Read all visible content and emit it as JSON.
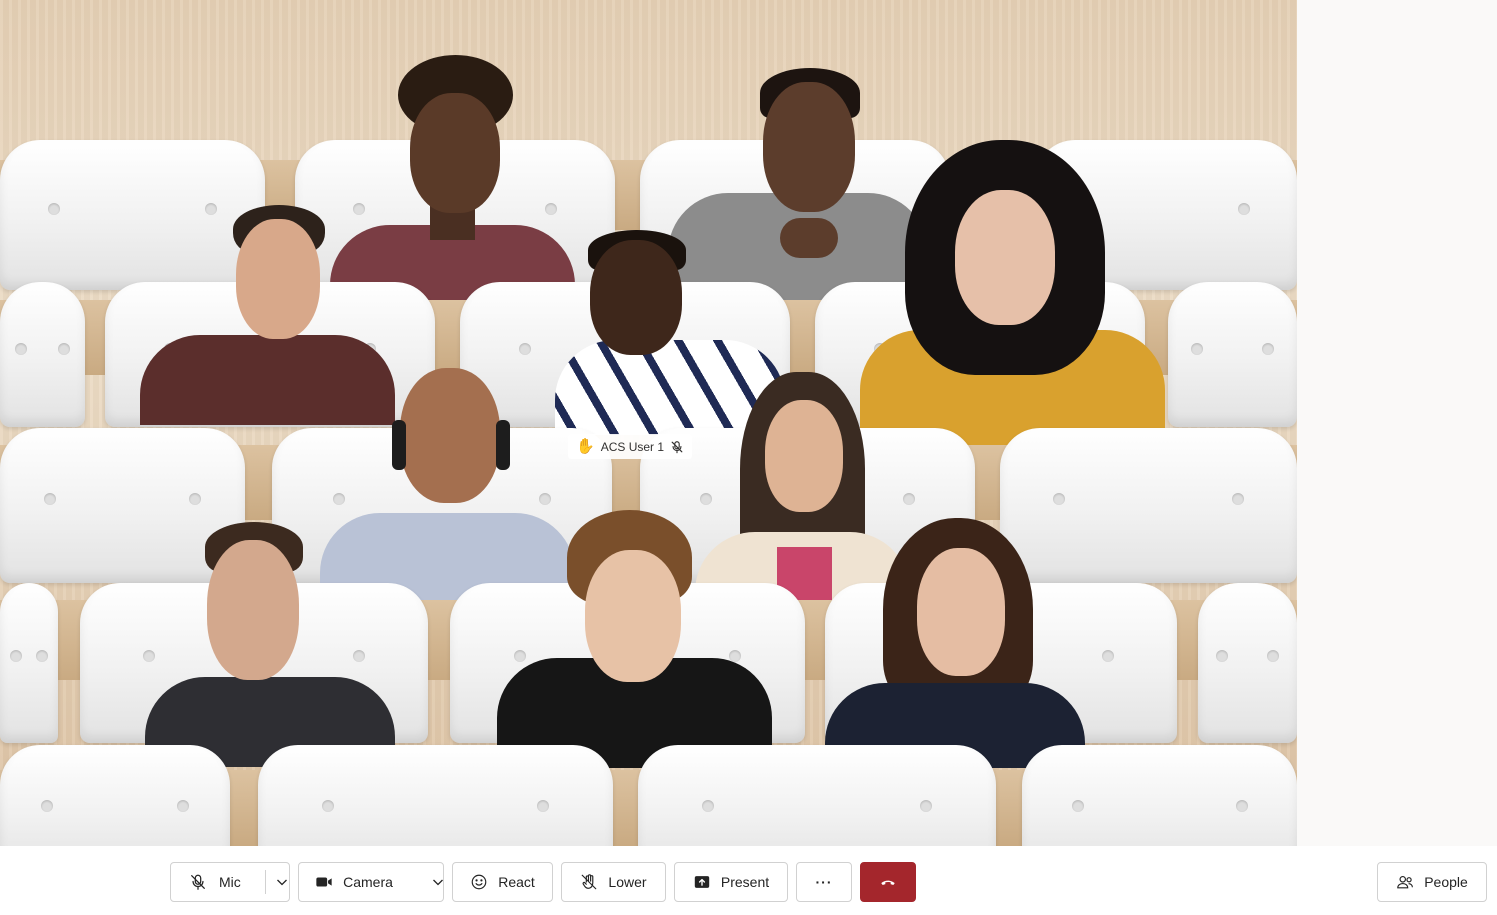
{
  "participant_tag": {
    "name": "ACS User 1",
    "hand_raised_icon": "raised-hand-icon",
    "muted_icon": "mic-off-icon"
  },
  "controls": {
    "mic_label": "Mic",
    "camera_label": "Camera",
    "react_label": "React",
    "lower_label": "Lower",
    "present_label": "Present",
    "more_label": "···",
    "people_label": "People"
  },
  "colors": {
    "hangup": "#a4262c",
    "hand": "#e8a33d",
    "right_panel": "#faf9f8"
  }
}
